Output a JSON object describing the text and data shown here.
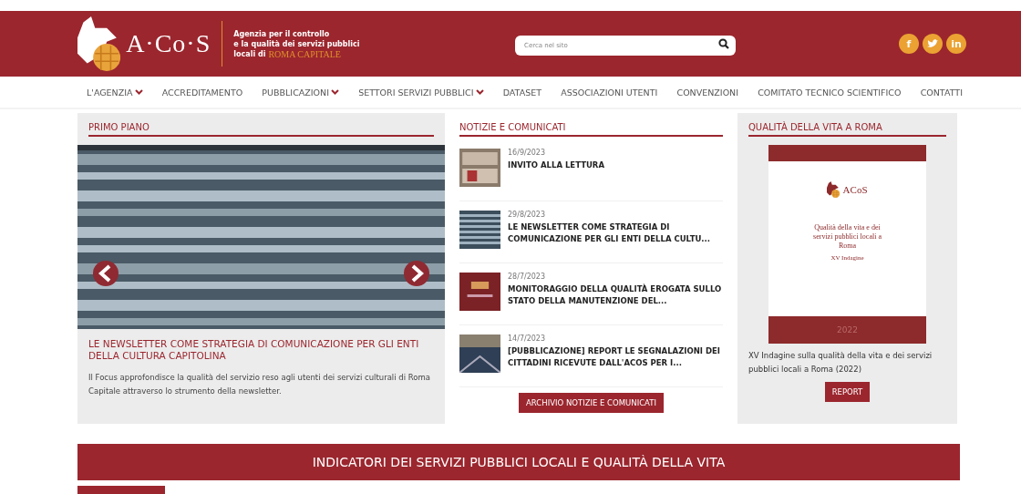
{
  "header": {
    "logo_text": "A·Co·S",
    "tagline": [
      "Agenzia per il controllo",
      "e la qualità  dei servizi pubblici"
    ],
    "tagline_last": "locali di",
    "tagline_highlight": "ROMA CAPITALE",
    "search": {
      "placeholder": "Cerca nel sito"
    },
    "social": [
      {
        "kind": "facebook",
        "label": "f"
      },
      {
        "kind": "twitter"
      },
      {
        "kind": "linkedin",
        "label": "in"
      }
    ]
  },
  "nav": [
    {
      "label": "L'AGENZIA",
      "has_menu": true
    },
    {
      "label": "ACCREDITAMENTO",
      "has_menu": false
    },
    {
      "label": "PUBBLICAZIONI",
      "has_menu": true
    },
    {
      "label": "SETTORI SERVIZI PUBBLICI",
      "has_menu": true
    },
    {
      "label": "DATASET",
      "has_menu": false
    },
    {
      "label": "ASSOCIAZIONI UTENTI",
      "has_menu": false
    },
    {
      "label": "CONVENZIONI",
      "has_menu": false
    },
    {
      "label": "COMITATO TECNICO SCIENTIFICO",
      "has_menu": false
    },
    {
      "label": "CONTATTI",
      "has_menu": false
    }
  ],
  "primo_piano": {
    "title": "PRIMO PIANO",
    "headline": "LE NEWSLETTER COME STRATEGIA DI COMUNICAZIONE PER GLI ENTI DELLA CULTURA CAPITOLINA",
    "description": "Il Focus approfondisce la qualità del servizio reso agli utenti dei servizi culturali di Roma Capitale attraverso lo strumento della newsletter."
  },
  "news": {
    "title": "NOTIZIE E COMUNICATI",
    "items": [
      {
        "date": "16/9/2023",
        "title": "INVITO ALLA LETTURA"
      },
      {
        "date": "29/8/2023",
        "title": "LE NEWSLETTER COME STRATEGIA DI COMUNICAZIONE PER GLI ENTI DELLA CULTU..."
      },
      {
        "date": "28/7/2023",
        "title": "MONITORAGGIO DELLA QUALITÀ EROGATA SULLO STATO DELLA MANUTENZIONE DEL..."
      },
      {
        "date": "14/7/2023",
        "title": "[PUBBLICAZIONE] REPORT LE SEGNALAZIONI DEI CITTADINI RICEVUTE DALL'ACOS PER I..."
      }
    ],
    "button": "ARCHIVIO NOTIZIE E COMUNICATI"
  },
  "quality": {
    "title": "QUALITÀ DELLA VITA A ROMA",
    "cover": {
      "logo_text": "ACoS",
      "title": "Qualità della vita e dei servizi pubblici locali a Roma",
      "subtitle": "XV Indagine",
      "year": "2022"
    },
    "caption": "XV Indagine sulla qualità della vita e dei servizi pubblici locali a Roma (2022)",
    "button": "REPORT"
  },
  "indicators": {
    "title": "INDICATORI DEI SERVIZI PUBBLICI LOCALI E QUALITÀ DELLA VITA"
  }
}
